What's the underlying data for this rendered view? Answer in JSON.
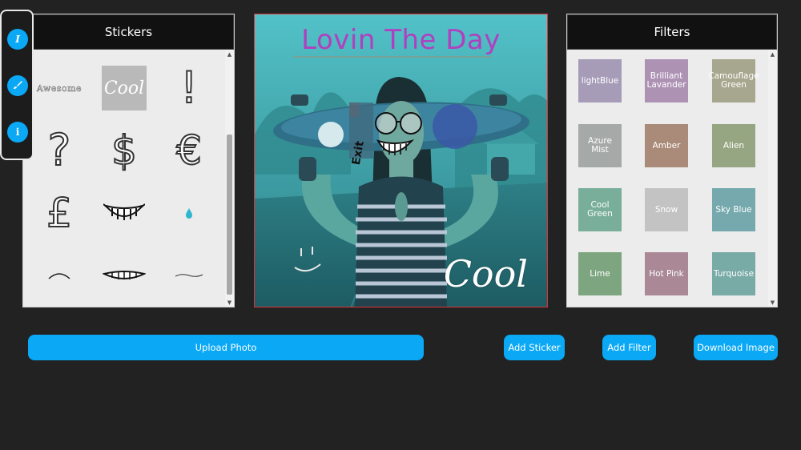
{
  "toolbar": {
    "text_tool": {
      "icon": "text-italic-icon",
      "glyph": "I"
    },
    "brush_tool": {
      "icon": "brush-icon"
    },
    "info_tool": {
      "icon": "info-icon",
      "glyph": "i"
    }
  },
  "stickers_panel": {
    "title": "Stickers",
    "items": [
      {
        "name": "awesome-text",
        "text": "Awesome"
      },
      {
        "name": "cool-badge",
        "text": "Cool"
      },
      {
        "name": "exclamation",
        "text": "!"
      },
      {
        "name": "question",
        "text": "?"
      },
      {
        "name": "dollar",
        "text": "$"
      },
      {
        "name": "euro",
        "text": "€"
      },
      {
        "name": "pound",
        "text": "£"
      },
      {
        "name": "grin"
      },
      {
        "name": "drop"
      },
      {
        "name": "brow"
      },
      {
        "name": "lips"
      },
      {
        "name": "tilde"
      }
    ]
  },
  "canvas": {
    "title_text": "Lovin The Day",
    "board_label": "Exit",
    "cool_text": "Cool",
    "accent_title": "#b040c0"
  },
  "filters_panel": {
    "title": "Filters",
    "items": [
      {
        "label": "lightBlue",
        "color": "#a79cb8"
      },
      {
        "label": "Brilliant Lavander",
        "color": "#ad92b4"
      },
      {
        "label": "Camouflage Green",
        "color": "#a7a78f"
      },
      {
        "label": "Azure Mist",
        "color": "#a5aaa8"
      },
      {
        "label": "Amber",
        "color": "#aa8a78"
      },
      {
        "label": "Alien",
        "color": "#97a682"
      },
      {
        "label": "Cool Green",
        "color": "#79ae9b"
      },
      {
        "label": "Snow",
        "color": "#c3c3c3"
      },
      {
        "label": "Sky Blue",
        "color": "#75a9ad"
      },
      {
        "label": "Lime",
        "color": "#7da580"
      },
      {
        "label": "Hot Pink",
        "color": "#aa8896"
      },
      {
        "label": "Turquoise",
        "color": "#78aaa6"
      }
    ]
  },
  "actions": {
    "upload": "Upload Photo",
    "add_sticker": "Add Sticker",
    "add_filter": "Add Filter",
    "download": "Download Image"
  },
  "colors": {
    "accent": "#0aa8f5",
    "background": "#222222"
  }
}
